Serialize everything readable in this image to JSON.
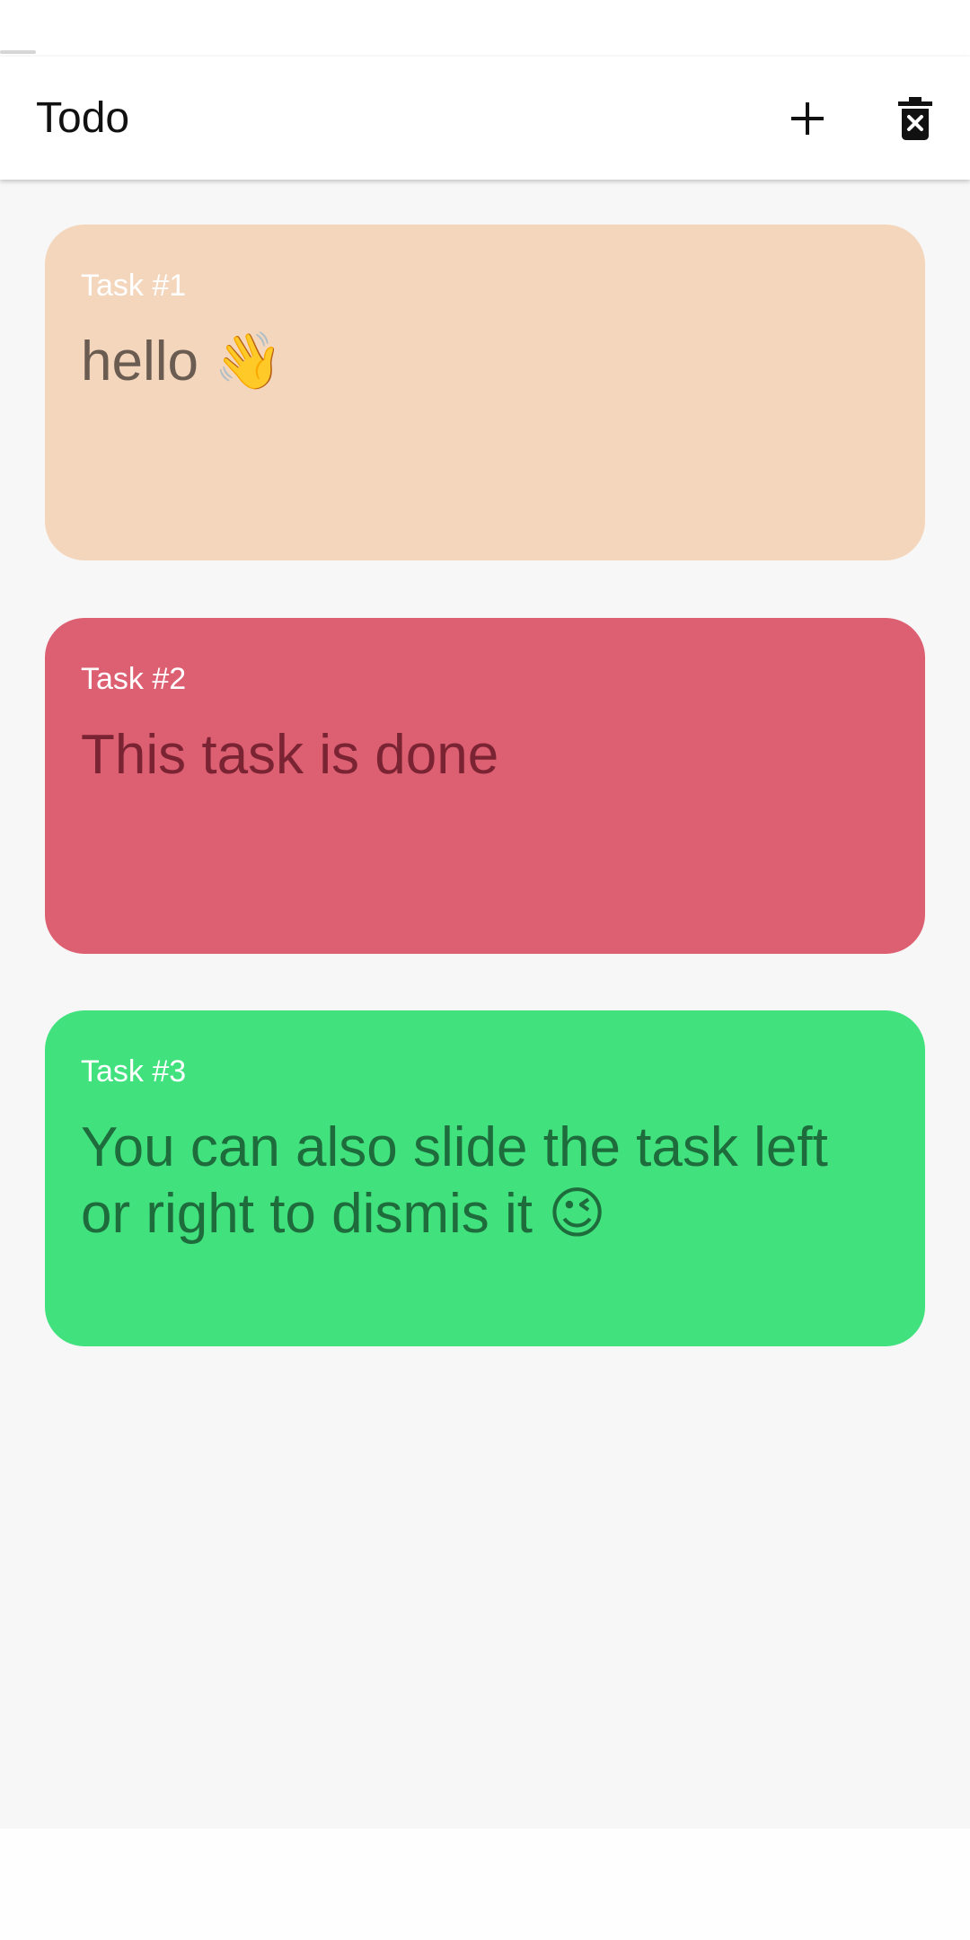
{
  "app_bar": {
    "title": "Todo",
    "add_icon": "plus-icon",
    "clear_icon": "delete-forever-icon"
  },
  "colors": {
    "app_bar_bg": "#ffffff",
    "content_bg": "#f7f7f7",
    "task_label": "#ffffff"
  },
  "tasks": [
    {
      "label": "Task #1",
      "text": "hello 👋",
      "background": "#f4d6bd",
      "text_color": "#6b5c52"
    },
    {
      "label": "Task #2",
      "text": "This task is done",
      "background": "#dd5f72",
      "text_color": "#7a2433"
    },
    {
      "label": "Task #3",
      "text": "You can also slide the task left or right to dismis it 😉",
      "background": "#41e27e",
      "text_color": "#1e6b3c"
    }
  ]
}
